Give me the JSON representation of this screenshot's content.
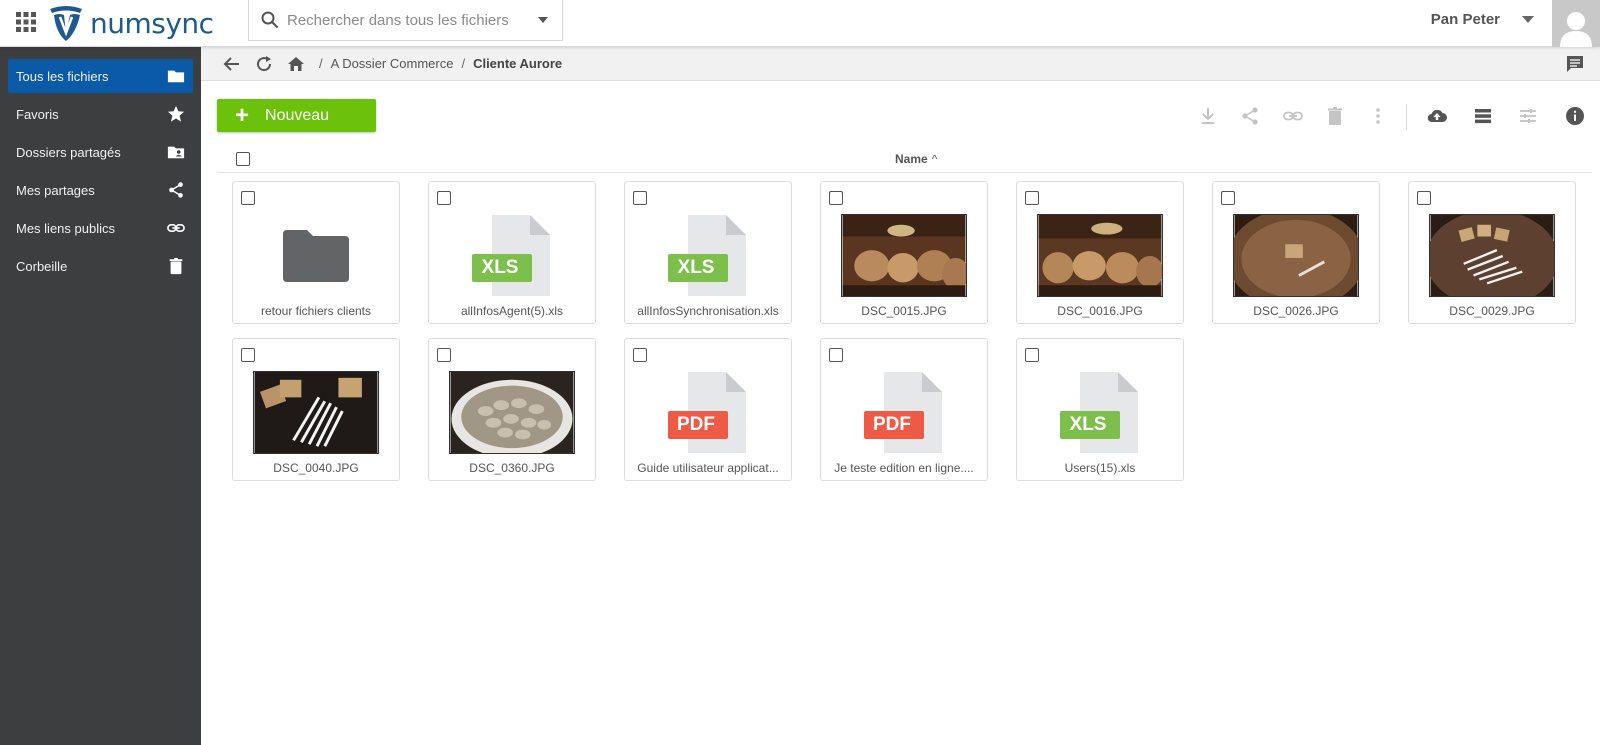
{
  "app": {
    "logo_text": "numsync"
  },
  "search": {
    "placeholder": "Rechercher dans tous les fichiers"
  },
  "user": {
    "name": "Pan Peter"
  },
  "sidebar": {
    "items": [
      {
        "label": "Tous les fichiers",
        "icon": "folder-icon",
        "active": true
      },
      {
        "label": "Favoris",
        "icon": "star-icon"
      },
      {
        "label": "Dossiers partagés",
        "icon": "shared-folder-icon"
      },
      {
        "label": "Mes partages",
        "icon": "share-icon"
      },
      {
        "label": "Mes liens publics",
        "icon": "link-icon"
      },
      {
        "label": "Corbeille",
        "icon": "trash-icon"
      }
    ]
  },
  "breadcrumb": {
    "parent": "A Dossier Commerce",
    "current": "Cliente Aurore",
    "separator": "/"
  },
  "toolbar": {
    "new_label": "Nouveau",
    "new_plus": "+"
  },
  "list_header": {
    "name_label": "Name",
    "sort_arrow": "^"
  },
  "files": [
    {
      "name": "retour fichiers clients",
      "type": "folder"
    },
    {
      "name": "allInfosAgent(5).xls",
      "type": "xls",
      "badge": "XLS"
    },
    {
      "name": "allInfosSynchronisation.xls",
      "type": "xls",
      "badge": "XLS"
    },
    {
      "name": "DSC_0015.JPG",
      "type": "photo-cellar"
    },
    {
      "name": "DSC_0016.JPG",
      "type": "photo-cellar"
    },
    {
      "name": "DSC_0026.JPG",
      "type": "photo-barrel"
    },
    {
      "name": "DSC_0029.JPG",
      "type": "photo-pens-barrel"
    },
    {
      "name": "DSC_0040.JPG",
      "type": "photo-pens"
    },
    {
      "name": "DSC_0360.JPG",
      "type": "photo-oysters"
    },
    {
      "name": "Guide utilisateur applicat...",
      "type": "pdf",
      "badge": "PDF"
    },
    {
      "name": "Je teste edition en ligne....",
      "type": "pdf",
      "badge": "PDF"
    },
    {
      "name": "Users(15).xls",
      "type": "xls",
      "badge": "XLS"
    }
  ],
  "colors": {
    "sidebar_bg": "#3d3e40",
    "sidebar_active": "#0b5aa8",
    "new_button": "#6cc10a",
    "xls_badge": "#7cc04b",
    "pdf_badge": "#ef5a47",
    "logo": "#1f5a8e"
  }
}
